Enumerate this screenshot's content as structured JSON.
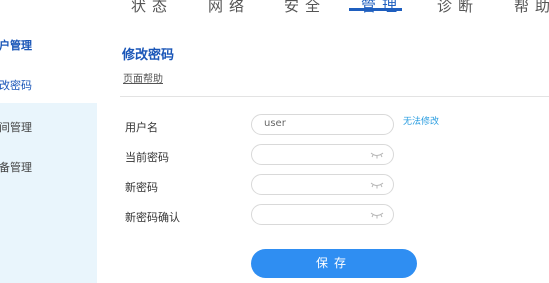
{
  "topnav": {
    "items": [
      "状态",
      "网络",
      "安全",
      "管理",
      "诊断",
      "帮助"
    ],
    "active_index": 3
  },
  "sidebar": {
    "group_label": "用户管理",
    "items": [
      {
        "label": "修改密码",
        "active": true
      },
      {
        "label": "时间管理",
        "active": false
      },
      {
        "label": "设备管理",
        "active": false
      }
    ]
  },
  "main": {
    "title": "修改密码",
    "help_link": "页面帮助",
    "form": {
      "username_label": "用户名",
      "username_value": "user",
      "username_note": "无法修改",
      "current_password_label": "当前密码",
      "new_password_label": "新密码",
      "confirm_password_label": "新密码确认"
    },
    "save_label": "保存"
  },
  "colors": {
    "accent": "#1a56b8",
    "button": "#2f8ef2",
    "sidebar_bg": "#e9f5fc",
    "note": "#2a9de0"
  },
  "icons": {
    "password_toggle": "eye-closed-icon"
  }
}
